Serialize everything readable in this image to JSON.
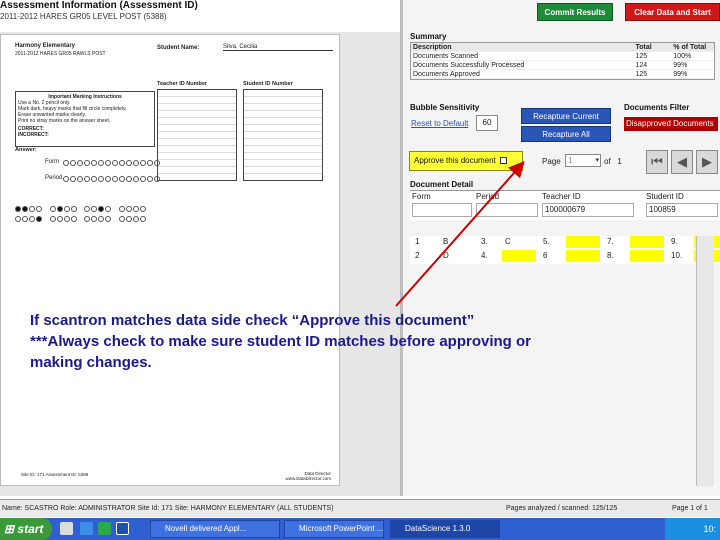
{
  "header": {
    "title": "Assessment Information (Assessment ID)",
    "subtitle": "2011-2012 HARES GR05 LEVEL POST (5388)"
  },
  "buttons": {
    "commit": "Commit Results",
    "clear": "Clear Data and Start"
  },
  "summary": {
    "title": "Summary",
    "headers": [
      "Description",
      "Total",
      "% of Total"
    ],
    "rows": [
      [
        "Documents Scanned",
        "125",
        "100%"
      ],
      [
        "Documents Successfully Processed",
        "124",
        "99%"
      ],
      [
        "Documents Approved",
        "125",
        "99%"
      ]
    ]
  },
  "bubble": {
    "title": "Bubble Sensitivity",
    "reset": "Reset to Default",
    "value": "60",
    "recapture_current": "Recapture Current",
    "recapture_all": "Recapture All"
  },
  "filter": {
    "title": "Documents Filter",
    "value": "Disapproved Documents"
  },
  "approve": {
    "label": "Approve this document",
    "page_label": "Page",
    "page_value": "1",
    "of_label": "of",
    "of_value": "1"
  },
  "detail": {
    "title": "Document Detail",
    "cols": [
      "Form",
      "Period",
      "Teacher ID",
      "Student ID"
    ],
    "teacher_id": "100000679",
    "student_id": "100859",
    "answers": [
      [
        "1",
        "B",
        "3.",
        "C",
        "5.",
        "",
        "7.",
        "",
        "9.",
        ""
      ],
      [
        "2",
        "D",
        "4.",
        "",
        "6",
        "",
        "8.",
        "",
        "10.",
        ""
      ]
    ]
  },
  "scan": {
    "school": "Harmony Elementary",
    "subtitle": "2011-2012 HARES GR05 RAWLS POST",
    "student_label": "Student Name:",
    "student_name": "Silva, Cecilia",
    "teacher_label": "Teacher ID Number",
    "student_id_label": "Student ID Number",
    "instructions_title": "Important Marking Instructions",
    "instructions": [
      "Use a No. 2 pencil only.",
      "Mark dark, heavy marks that fill circle completely.",
      "Erase unwanted marks clearly.",
      "Print no stray marks on the answer sheet."
    ],
    "correct": "CORRECT:",
    "incorrect": "INCORRECT:",
    "answer_label": "Answer:",
    "form_label": "Form",
    "period_label": "Period",
    "footer_left": "Site ID: 171   Assessment ID: 5388",
    "footer_right": "Data Director\nwww.DataDirector.com"
  },
  "note": {
    "line1": "If scantron matches data side check “Approve this document”",
    "line2": "***Always check to make sure student ID matches before approving or",
    "line3": "making changes."
  },
  "status": "Name: SCASTRO  Role: ADMINISTRATOR  Site Id: 171  Site: HARMONY ELEMENTARY (ALL STUDENTS)",
  "status_right": "Pages analyzed / scanned: 125/125",
  "status_page": "Page 1 of 1",
  "taskbar": {
    "start": "start",
    "items": [
      "Novell delivered Appl...",
      "Microsoft PowerPoint ...",
      "DataScience 1.3.0"
    ],
    "clock": "10:"
  }
}
